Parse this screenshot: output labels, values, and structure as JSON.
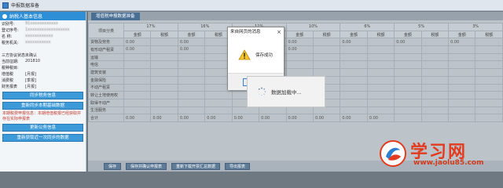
{
  "window": {
    "title": "申报数据准备"
  },
  "sidebar": {
    "header": "纳税人基本信息",
    "rows": [
      {
        "label": "识别号:",
        "value": "91xxxxxxxxxxxx",
        "blur": true
      },
      {
        "label": "登记序号:",
        "value": "1xxxxxxxxxxxxxxxxxx",
        "blur": true
      },
      {
        "label": "名 称:",
        "value": "xxxxxxxxxxxx",
        "blur": true
      },
      {
        "label": "税务机关:",
        "value": "xxxxxxxxxxx",
        "blur": true
      },
      {
        "label": "",
        "value": "",
        "blur": false
      },
      {
        "label": "三方协议状态:",
        "value": "未确认",
        "blur": false
      },
      {
        "label": "当前征期:",
        "value": "201810",
        "blur": false
      },
      {
        "label": "税种税目:",
        "value": "",
        "blur": false
      },
      {
        "label": "增值税",
        "value": "[月报]",
        "blur": false
      },
      {
        "label": "消费税",
        "value": "[季报]",
        "blur": false
      },
      {
        "label": "财务报表",
        "value": "[月报]",
        "blur": false
      }
    ],
    "buttons": [
      "同步税务信息",
      "重新同步本期基础数据"
    ],
    "note": "本期税费申报信息：本期增值税报已经获取并存在实际申报表",
    "buttons2": [
      "更新公务信息",
      "重新获取近一次同步的数据"
    ]
  },
  "main": {
    "tab": "增值税申报数据准备",
    "table": {
      "rate_headers": [
        "17%",
        "16%",
        "11%",
        "10%",
        "6%",
        "5%",
        "3%"
      ],
      "sub_headers": [
        "金额",
        "税额"
      ],
      "first_col_header": "项目分类",
      "rows": [
        {
          "cat": "货物及劳务",
          "vals": [
            "0.00",
            "",
            "0.00",
            "",
            "0.00",
            "",
            "0.00",
            "",
            "0.00",
            "",
            "0.00",
            "",
            "0.00",
            ""
          ]
        },
        {
          "cat": "有形动产租赁",
          "vals": [
            "0.00",
            "",
            "0.00",
            "",
            "0.00",
            "",
            "0.00",
            "",
            "",
            "",
            "",
            "",
            "",
            ""
          ]
        },
        {
          "cat": "运输",
          "vals": [
            "",
            "",
            "",
            "",
            "",
            "",
            "",
            "",
            "",
            "",
            "",
            "",
            "",
            ""
          ]
        },
        {
          "cat": "电信",
          "vals": [
            "",
            "",
            "",
            "",
            "",
            "",
            "",
            "",
            "",
            "",
            "",
            "",
            "",
            ""
          ]
        },
        {
          "cat": "建筑安装",
          "vals": [
            "",
            "",
            "",
            "",
            "",
            "",
            "",
            "",
            "",
            "",
            "",
            "",
            "",
            ""
          ]
        },
        {
          "cat": "金融保险",
          "vals": [
            "",
            "",
            "",
            "",
            "",
            "",
            "",
            "",
            "",
            "",
            "",
            "",
            "",
            ""
          ]
        },
        {
          "cat": "不动产租赁",
          "vals": [
            "",
            "",
            "",
            "",
            "",
            "",
            "",
            "",
            "",
            "",
            "",
            "",
            "",
            ""
          ]
        },
        {
          "cat": "转让土地使用权",
          "vals": [
            "",
            "",
            "",
            "",
            "",
            "",
            "",
            "",
            "",
            "",
            "",
            "",
            "",
            ""
          ]
        },
        {
          "cat": "取得不动产",
          "vals": [
            "",
            "",
            "",
            "",
            "",
            "",
            "",
            "",
            "",
            "",
            "",
            "",
            "",
            ""
          ]
        },
        {
          "cat": "生活服务",
          "vals": [
            "",
            "",
            "",
            "",
            "",
            "",
            "",
            "",
            "",
            "",
            "",
            "",
            "",
            ""
          ]
        },
        {
          "cat": "合计",
          "vals": [
            "0.00",
            "0.00",
            "0.00",
            "0.00",
            "0.00",
            "0.00",
            "0.00",
            "0.00",
            "0.00",
            "0.00",
            "",
            "",
            "",
            ""
          ]
        }
      ]
    },
    "bottom_buttons": [
      "保存",
      "保存并确认申报表",
      "重新下载开票汇总数据",
      "导出报表"
    ]
  },
  "dialog": {
    "title": "来自网页的消息",
    "close": "×",
    "message": "保存成功",
    "ok": "确定"
  },
  "loading": {
    "text": "数据加载中..."
  },
  "watermark": {
    "text": "学习网",
    "url": "www.jaolu85.com"
  }
}
